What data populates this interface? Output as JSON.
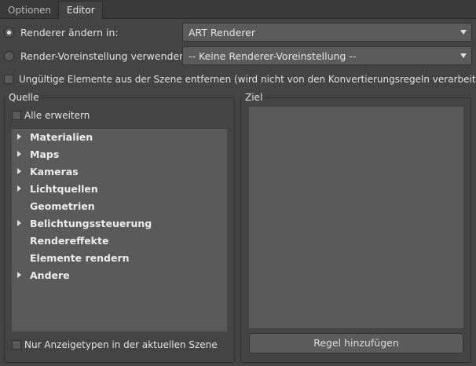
{
  "tabs": [
    "Optionen",
    "Editor"
  ],
  "renderer": {
    "change_label": "Renderer ändern in:",
    "change_value": "ART Renderer",
    "preset_label": "Render-Voreinstellung verwenden:",
    "preset_value": "-- Keine Renderer-Voreinstellung --"
  },
  "remove_invalid_label": "Ungültige Elemente aus der Szene entfernen (wird nicht von den Konvertierungsregeln verarbeitet)",
  "source": {
    "title": "Quelle",
    "expand_all_label": "Alle erweitern",
    "items": [
      {
        "label": "Materialien",
        "expandable": true
      },
      {
        "label": "Maps",
        "expandable": true
      },
      {
        "label": "Kameras",
        "expandable": true
      },
      {
        "label": "Lichtquellen",
        "expandable": true
      },
      {
        "label": "Geometrien",
        "expandable": false
      },
      {
        "label": "Belichtungssteuerung",
        "expandable": true
      },
      {
        "label": "Rendereffekte",
        "expandable": false
      },
      {
        "label": "Elemente rendern",
        "expandable": false
      },
      {
        "label": "Andere",
        "expandable": true
      }
    ],
    "only_scene_types_label": "Nur Anzeigetypen in der aktuellen Szene"
  },
  "target": {
    "title": "Ziel",
    "add_rule_label": "Regel hinzufügen"
  },
  "icons": {
    "expand": "triangle-right-icon",
    "dropdown": "chevron-down-icon"
  }
}
